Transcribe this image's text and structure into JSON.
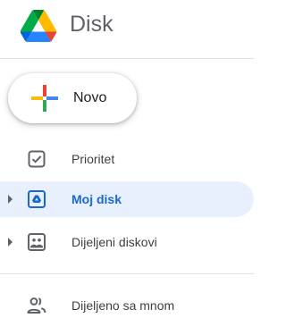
{
  "header": {
    "app_title": "Disk",
    "logo_icon": "google-drive-logo"
  },
  "new_button": {
    "label": "Novo",
    "icon": "multicolor-plus-icon"
  },
  "nav": {
    "items": [
      {
        "label": "Prioritet",
        "icon": "checkbox-icon",
        "expandable": false,
        "active": false
      },
      {
        "label": "Moj disk",
        "icon": "drive-folder-icon",
        "expandable": true,
        "active": true
      },
      {
        "label": "Dijeljeni diskovi",
        "icon": "shared-drive-icon",
        "expandable": true,
        "active": false
      },
      {
        "label": "Dijeljeno sa mnom",
        "icon": "people-icon",
        "expandable": false,
        "active": false
      }
    ]
  },
  "colors": {
    "active_background": "#e8f0fe",
    "active_text": "#1967d2",
    "icon_gray": "#5f6368",
    "plus_blue": "#4285f4",
    "plus_red": "#ea4335",
    "plus_yellow": "#fbbc04",
    "plus_green": "#34a853"
  }
}
